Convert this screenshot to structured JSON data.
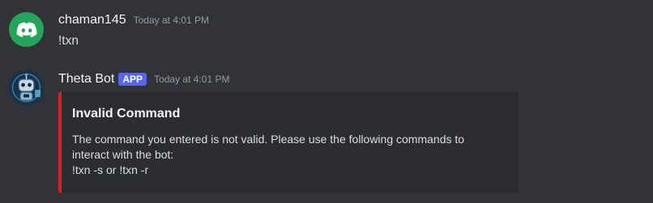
{
  "messages": [
    {
      "username": "chaman145",
      "timestamp": "Today at 4:01 PM",
      "content": "!txn",
      "avatar_icon": "discord-logo-icon",
      "avatar_color": "#23a55a"
    },
    {
      "username": "Theta Bot",
      "badge": "APP",
      "timestamp": "Today at 4:01 PM",
      "avatar_icon": "robot-icon",
      "embed": {
        "accent_color": "#e01e26",
        "title": "Invalid Command",
        "description_lines": [
          "The command you entered is not valid. Please use the following commands to",
          "interact with the bot:",
          "!txn -s or !txn -r"
        ]
      }
    }
  ],
  "colors": {
    "background": "#313338",
    "embed_background": "#2b2d31",
    "badge": "#5865f2"
  }
}
